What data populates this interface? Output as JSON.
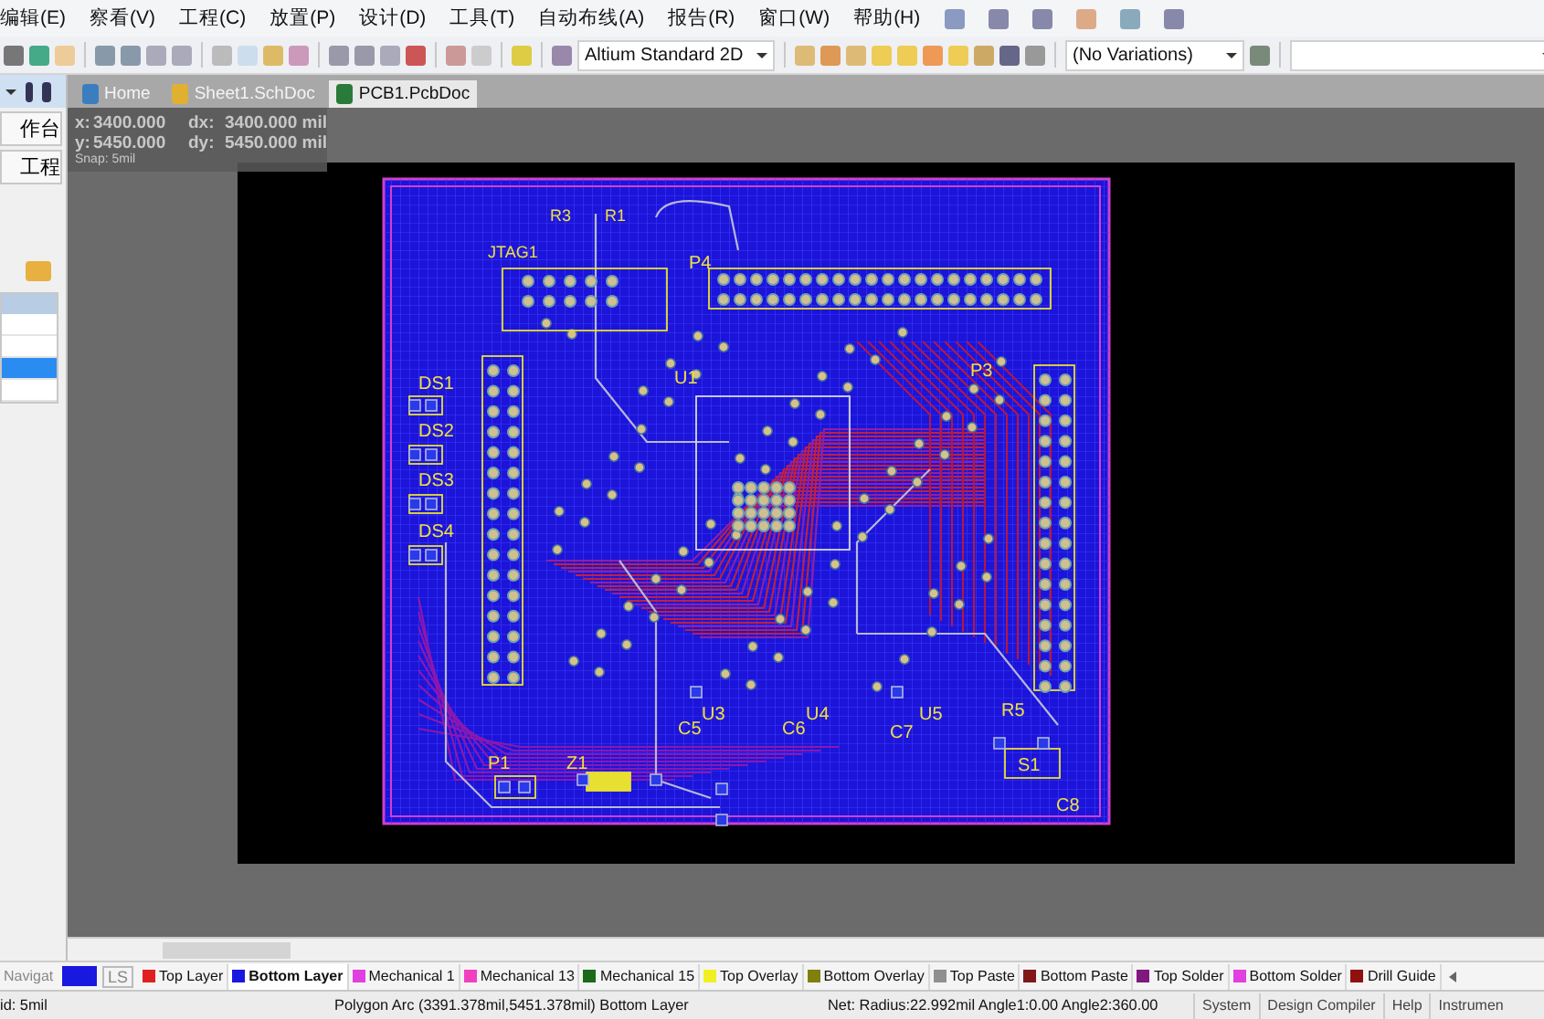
{
  "menu": [
    "编辑(E)",
    "察看(V)",
    "工程(C)",
    "放置(P)",
    "设计(D)",
    "工具(T)",
    "自动布线(A)",
    "报告(R)",
    "窗口(W)",
    "帮助(H)"
  ],
  "toolbar": {
    "view_dropdown": "Altium Standard 2D",
    "variant_dropdown": "(No Variations)"
  },
  "panel": {
    "buttons": [
      "作台",
      "工程"
    ],
    "list_rows": [
      {
        "selected": false
      },
      {
        "selected": false
      },
      {
        "selected": true
      },
      {
        "selected": false
      }
    ]
  },
  "doc_tabs": [
    {
      "label": "Home",
      "selected": false,
      "kind": "home"
    },
    {
      "label": "Sheet1.SchDoc",
      "selected": false,
      "kind": "sch"
    },
    {
      "label": "PCB1.PcbDoc",
      "selected": true,
      "kind": "pcb"
    }
  ],
  "readout": {
    "rows": [
      [
        "x:",
        "3400.000",
        "dx:",
        "3400.000 mil"
      ],
      [
        "y:",
        "5450.000",
        "dy:",
        "5450.000 mil"
      ]
    ],
    "snap": "Snap: 5mil"
  },
  "designators": [
    "R3",
    "R1",
    "JTAG1",
    "P4",
    "DS1",
    "U1",
    "P3",
    "DS2",
    "DS3",
    "DS4",
    "U3",
    "U4",
    "U5",
    "R5",
    "C5",
    "C6",
    "C7",
    "P1",
    "Z1",
    "S1",
    "C8"
  ],
  "layer_bar": {
    "navigator": "Navigat",
    "ls": "LS",
    "layers": [
      {
        "name": "Top Layer",
        "color": "#e02020",
        "selected": false
      },
      {
        "name": "Bottom Layer",
        "color": "#1818e0",
        "selected": true
      },
      {
        "name": "Mechanical 1",
        "color": "#e040e0",
        "selected": false
      },
      {
        "name": "Mechanical 13",
        "color": "#f040c0",
        "selected": false
      },
      {
        "name": "Mechanical 15",
        "color": "#1a6a1a",
        "selected": false
      },
      {
        "name": "Top Overlay",
        "color": "#f0f020",
        "selected": false
      },
      {
        "name": "Bottom Overlay",
        "color": "#808010",
        "selected": false
      },
      {
        "name": "Top Paste",
        "color": "#909090",
        "selected": false
      },
      {
        "name": "Bottom Paste",
        "color": "#801818",
        "selected": false
      },
      {
        "name": "Top Solder",
        "color": "#801880",
        "selected": false
      },
      {
        "name": "Bottom Solder",
        "color": "#e040e0",
        "selected": false
      },
      {
        "name": "Drill Guide",
        "color": "#901010",
        "selected": false
      }
    ]
  },
  "status": {
    "grid": "id: 5mil",
    "object": "Polygon Arc (3391.378mil,5451.378mil)  Bottom Layer",
    "net": "Net:  Radius:22.992mil Angle1:0.00 Angle2:360.00",
    "buttons": [
      "System",
      "Design Compiler",
      "Help",
      "Instrumen"
    ]
  }
}
